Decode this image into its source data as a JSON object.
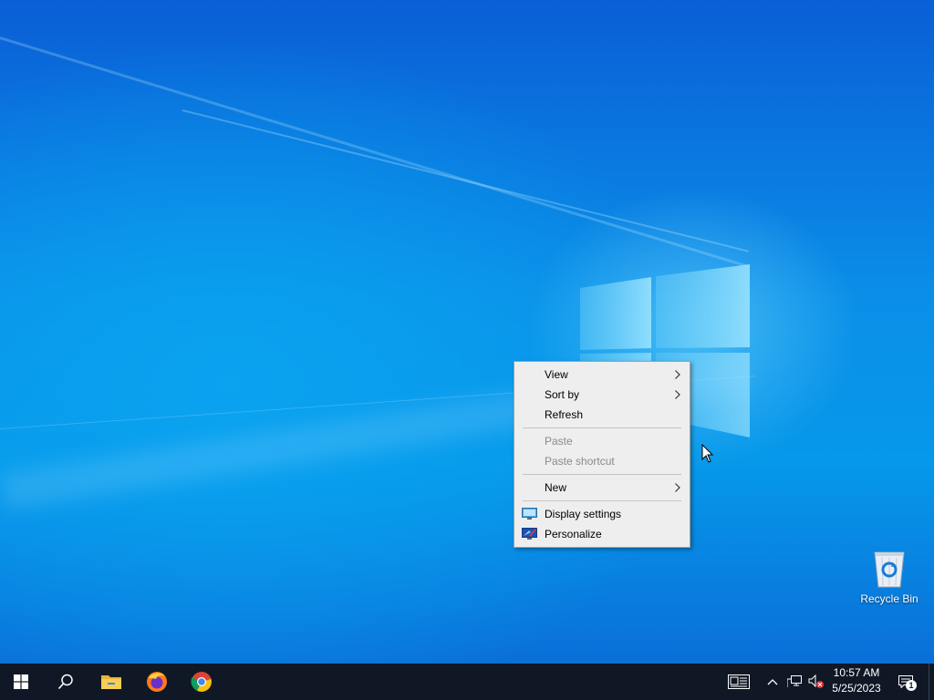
{
  "desktop": {
    "icons": [
      {
        "label": "Recycle Bin",
        "icon": "recycle-bin-icon"
      }
    ]
  },
  "context_menu": {
    "items": [
      {
        "label": "View",
        "submenu": true,
        "enabled": true
      },
      {
        "label": "Sort by",
        "submenu": true,
        "enabled": true
      },
      {
        "label": "Refresh",
        "submenu": false,
        "enabled": true
      },
      {
        "label": "Paste",
        "submenu": false,
        "enabled": false
      },
      {
        "label": "Paste shortcut",
        "submenu": false,
        "enabled": false
      },
      {
        "label": "New",
        "submenu": true,
        "enabled": true
      },
      {
        "label": "Display settings",
        "icon": "display-settings-icon",
        "enabled": true
      },
      {
        "label": "Personalize",
        "icon": "personalize-icon",
        "enabled": true
      }
    ]
  },
  "taskbar": {
    "pinned": [
      "start-icon",
      "search-icon",
      "file-explorer-icon",
      "firefox-icon",
      "chrome-icon"
    ],
    "tray": [
      "news-icon",
      "chevron-up-icon",
      "network-icon",
      "volume-muted-icon"
    ],
    "clock": {
      "time": "10:57 AM",
      "date": "5/25/2023"
    },
    "notifications": {
      "count": "1"
    }
  },
  "colors": {
    "taskbar": "#101826",
    "menu_bg": "#eeeeee",
    "wallpaper": "#0a8fe8",
    "disabled_text": "#8a8a8a"
  }
}
